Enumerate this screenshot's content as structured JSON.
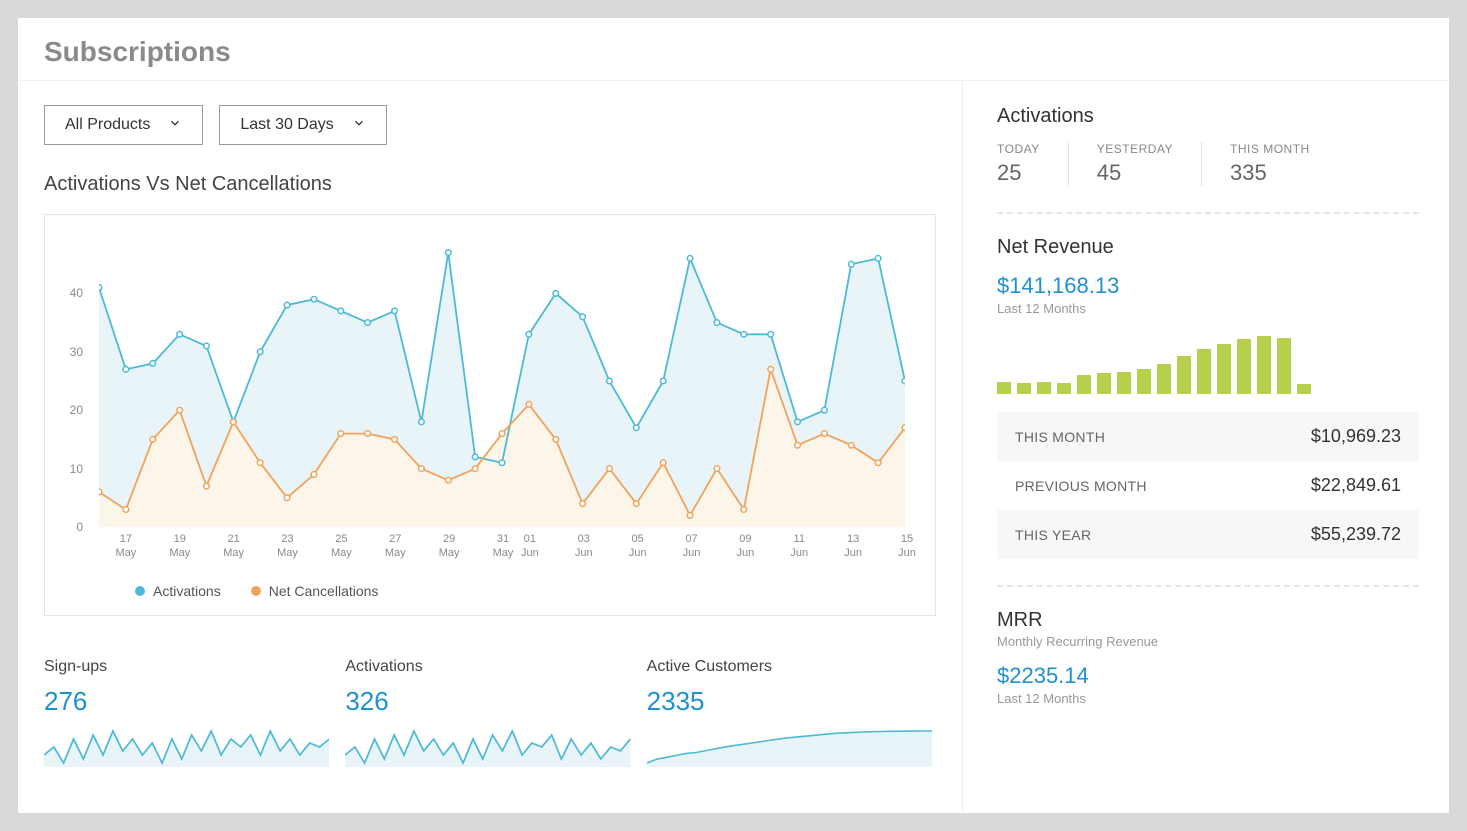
{
  "page": {
    "title": "Subscriptions"
  },
  "filters": {
    "product": "All Products",
    "range": "Last 30 Days"
  },
  "chart": {
    "title": "Activations Vs Net Cancellations",
    "legend": {
      "a": "Activations",
      "b": "Net Cancellations"
    },
    "colors": {
      "a": "#4dbad5",
      "b": "#f0a35b",
      "a_fill": "#e9f4f8",
      "b_fill": "#fcf5e9"
    }
  },
  "chart_data": {
    "type": "line",
    "x": [
      "16 May",
      "17 May",
      "18 May",
      "19 May",
      "20 May",
      "21 May",
      "22 May",
      "23 May",
      "24 May",
      "25 May",
      "26 May",
      "27 May",
      "28 May",
      "29 May",
      "30 May",
      "31 May",
      "01 Jun",
      "02 Jun",
      "03 Jun",
      "04 Jun",
      "05 Jun",
      "06 Jun",
      "07 Jun",
      "08 Jun",
      "09 Jun",
      "10 Jun",
      "11 Jun",
      "12 Jun",
      "13 Jun",
      "14 Jun",
      "15 Jun"
    ],
    "series": [
      {
        "name": "Activations",
        "values": [
          41,
          27,
          28,
          33,
          31,
          18,
          30,
          38,
          39,
          37,
          35,
          37,
          18,
          47,
          12,
          11,
          33,
          40,
          36,
          25,
          17,
          25,
          46,
          35,
          33,
          33,
          18,
          20,
          45,
          46,
          25
        ]
      },
      {
        "name": "Net Cancellations",
        "values": [
          6,
          3,
          15,
          20,
          7,
          18,
          11,
          5,
          9,
          16,
          16,
          15,
          10,
          8,
          10,
          16,
          21,
          15,
          4,
          10,
          4,
          11,
          2,
          10,
          3,
          27,
          14,
          16,
          14,
          11,
          17
        ]
      }
    ],
    "x_tick_labels": [
      "17 May",
      "19 May",
      "21 May",
      "23 May",
      "25 May",
      "27 May",
      "29 May",
      "31 May",
      "01 Jun",
      "03 Jun",
      "05 Jun",
      "07 Jun",
      "09 Jun",
      "11 Jun",
      "13 Jun",
      "15 Jun"
    ],
    "x_tick_idx": [
      1,
      3,
      5,
      7,
      9,
      11,
      13,
      15,
      16,
      18,
      20,
      22,
      24,
      26,
      28,
      30
    ],
    "yticks": [
      0,
      10,
      20,
      30,
      40
    ],
    "ylim": [
      0,
      50
    ],
    "xlabel": "",
    "ylabel": ""
  },
  "summary": {
    "signups": {
      "label": "Sign-ups",
      "value": "276"
    },
    "activations": {
      "label": "Activations",
      "value": "326"
    },
    "active": {
      "label": "Active Customers",
      "value": "2335"
    }
  },
  "spark_data": {
    "signups": [
      12,
      14,
      10,
      16,
      11,
      17,
      12,
      18,
      13,
      16,
      12,
      15,
      10,
      16,
      11,
      17,
      13,
      18,
      12,
      16,
      14,
      17,
      12,
      18,
      13,
      16,
      12,
      15,
      14,
      16
    ],
    "activations": [
      13,
      15,
      11,
      17,
      12,
      18,
      13,
      19,
      14,
      17,
      13,
      16,
      11,
      17,
      12,
      18,
      14,
      19,
      13,
      16,
      15,
      18,
      12,
      17,
      13,
      16,
      12,
      15,
      14,
      17
    ],
    "active": [
      2000,
      2040,
      2060,
      2080,
      2100,
      2110,
      2130,
      2150,
      2170,
      2185,
      2200,
      2215,
      2230,
      2245,
      2260,
      2270,
      2280,
      2290,
      2300,
      2310,
      2315,
      2320,
      2325,
      2328,
      2330,
      2332,
      2333,
      2334,
      2335,
      2335
    ]
  },
  "side": {
    "activations": {
      "title": "Activations",
      "today": {
        "label": "TODAY",
        "value": "25"
      },
      "yesterday": {
        "label": "YESTERDAY",
        "value": "45"
      },
      "this_month": {
        "label": "THIS MONTH",
        "value": "335"
      }
    },
    "revenue": {
      "title": "Net Revenue",
      "amount": "$141,168.13",
      "sub": "Last 12 Months",
      "bars": [
        12,
        11,
        12,
        11,
        19,
        21,
        22,
        25,
        30,
        38,
        45,
        50,
        55,
        58,
        56,
        10
      ],
      "rows": {
        "this_month": {
          "label": "THIS MONTH",
          "value": "$10,969.23"
        },
        "prev_month": {
          "label": "PREVIOUS MONTH",
          "value": "$22,849.61"
        },
        "this_year": {
          "label": "THIS YEAR",
          "value": "$55,239.72"
        }
      }
    },
    "mrr": {
      "title": "MRR",
      "subtitle": "Monthly Recurring Revenue",
      "amount": "$2235.14",
      "sub": "Last 12 Months"
    }
  }
}
